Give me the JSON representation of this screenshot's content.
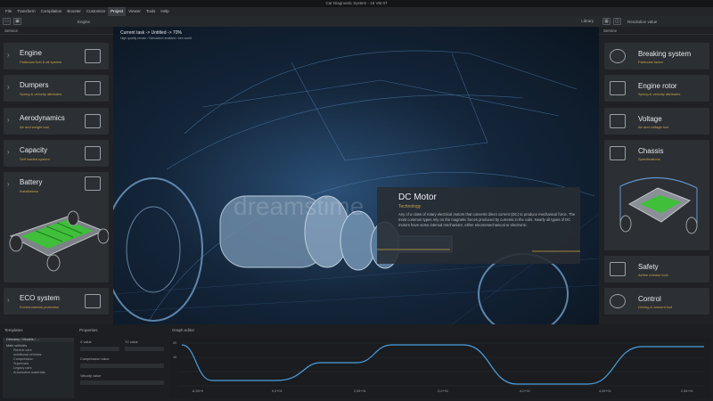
{
  "window": {
    "title": "Car Diagnostic System - 15 VM 07"
  },
  "menu": [
    "File",
    "Transform",
    "Compilation",
    "Booster",
    "Customize",
    "Project",
    "Viewer",
    "Tools",
    "Help"
  ],
  "menu_active": "Project",
  "toolbar": {
    "title": "Engine",
    "library": "Library",
    "resolution": "Resolution value"
  },
  "left_panel": {
    "header": "Service",
    "items": [
      {
        "title": "Engine",
        "sub": "Particular fuel & all system",
        "icon": "engine-icon"
      },
      {
        "title": "Dumpers",
        "sub": "Spring & velocity attributes",
        "icon": "dumper-icon"
      },
      {
        "title": "Aerodynamics",
        "sub": "Air and weight tool",
        "icon": "aerodynamics-icon"
      },
      {
        "title": "Capacity",
        "sub": "Self loaded system",
        "icon": "capacity-icon"
      },
      {
        "title": "Battery",
        "sub": "Installations",
        "icon": "battery-icon"
      },
      {
        "title": "ECO system",
        "sub": "Environmental protection",
        "icon": "eco-icon"
      }
    ]
  },
  "right_panel": {
    "header": "Service",
    "items": [
      {
        "title": "Breaking system",
        "sub": "Particular factor",
        "icon": "brake-disc-icon"
      },
      {
        "title": "Engine rotor",
        "sub": "Spring & velocity attributes",
        "icon": "engine-rotor-icon"
      },
      {
        "title": "Voltage",
        "sub": "Air and voltage tool",
        "icon": "voltage-icon"
      },
      {
        "title": "Chassis",
        "sub": "Specifications",
        "icon": "chassis-icon"
      },
      {
        "title": "Safety",
        "sub": "Airline release lock",
        "icon": "safety-icon"
      },
      {
        "title": "Control",
        "sub": "Driving & amount tool",
        "icon": "steering-wheel-icon"
      }
    ]
  },
  "viewport": {
    "info_line1": "Current task -> Untitled -> 70%",
    "info_line2": "High quality render / Simulation enabled / hex world",
    "watermark": "dreamstime",
    "callout": {
      "title": "DC Motor",
      "subtitle": "Technology",
      "description": "Any of a class of rotary electrical motors that converts direct current (DC) to produce mechanical force. The most common types rely on the magnetic forces produced by currents in the coils. Nearly all types of DC motors have some internal mechanism, either electromechanical or electronic."
    }
  },
  "bottom": {
    "templates_label": "Templates",
    "properties_label": "Properties",
    "graph_label": "Graph editor",
    "tree": {
      "header": "Directory / Models / ...",
      "root": "Main vehicles",
      "children": [
        "Electric cars",
        "Additional vehicles",
        "Compression",
        "Supercars",
        "Legacy cars",
        "Automotive materials"
      ]
    },
    "fields": [
      {
        "label": "X value"
      },
      {
        "label": "Y2 value"
      },
      {
        "label": "Compression value"
      },
      {
        "label": "Velocity value"
      }
    ],
    "graph": {
      "y_labels": [
        "20",
        "10"
      ],
      "ticks": [
        "-6,26+6",
        "0,0+01",
        "2,06+01",
        "-3,0+01",
        "-4,0+01",
        "4,05+01",
        "2,06+01"
      ]
    }
  },
  "colors": {
    "accent": "#c7a44a",
    "panel": "#2c2f33",
    "graph_line": "#4a9fe0"
  }
}
